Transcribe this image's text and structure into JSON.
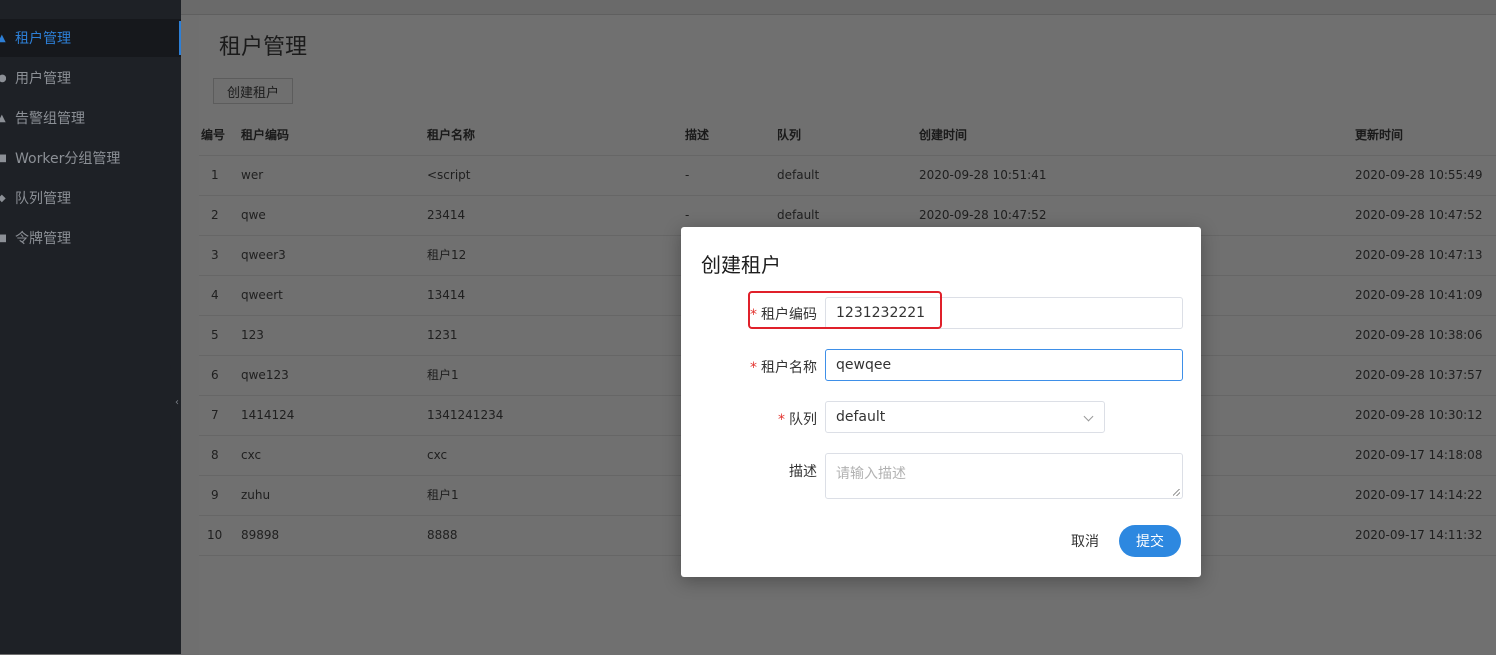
{
  "sidebar": {
    "items": [
      {
        "label": "租户管理",
        "icon": "user-icon",
        "active": true
      },
      {
        "label": "用户管理",
        "icon": "person-icon",
        "active": false
      },
      {
        "label": "告警组管理",
        "icon": "warning-icon",
        "active": false
      },
      {
        "label": "Worker分组管理",
        "icon": "server-icon",
        "active": false
      },
      {
        "label": "队列管理",
        "icon": "queue-icon",
        "active": false
      },
      {
        "label": "令牌管理",
        "icon": "token-icon",
        "active": false
      }
    ],
    "collapse_glyph": "‹"
  },
  "page": {
    "title": "租户管理",
    "create_button": "创建租户"
  },
  "table": {
    "headers": {
      "index": "编号",
      "code": "租户编码",
      "name": "租户名称",
      "desc": "描述",
      "queue": "队列",
      "created": "创建时间",
      "updated": "更新时间"
    },
    "rows": [
      {
        "index": "1",
        "code": "wer",
        "name": "<script",
        "desc": "-",
        "queue": "default",
        "created": "2020-09-28 10:51:41",
        "updated": "2020-09-28 10:55:49"
      },
      {
        "index": "2",
        "code": "qwe",
        "name": "23414",
        "desc": "-",
        "queue": "default",
        "created": "2020-09-28 10:47:52",
        "updated": "2020-09-28 10:47:52"
      },
      {
        "index": "3",
        "code": "qweer3",
        "name": "租户12",
        "desc": "",
        "queue": "",
        "created": "",
        "updated": "2020-09-28 10:47:13"
      },
      {
        "index": "4",
        "code": "qweert",
        "name": "13414",
        "desc": "",
        "queue": "",
        "created": "",
        "updated": "2020-09-28 10:41:09"
      },
      {
        "index": "5",
        "code": "123",
        "name": "1231",
        "desc": "",
        "queue": "",
        "created": "",
        "updated": "2020-09-28 10:38:06"
      },
      {
        "index": "6",
        "code": "qwe123",
        "name": "租户1",
        "desc": "",
        "queue": "",
        "created": "",
        "updated": "2020-09-28 10:37:57"
      },
      {
        "index": "7",
        "code": "1414124",
        "name": "1341241234",
        "desc": "",
        "queue": "",
        "created": "",
        "updated": "2020-09-28 10:30:12"
      },
      {
        "index": "8",
        "code": "cxc",
        "name": "cxc",
        "desc": "",
        "queue": "",
        "created": "",
        "updated": "2020-09-17 14:18:08"
      },
      {
        "index": "9",
        "code": "zuhu",
        "name": "租户1",
        "desc": "",
        "queue": "",
        "created": "",
        "updated": "2020-09-17 14:14:22"
      },
      {
        "index": "10",
        "code": "89898",
        "name": "8888",
        "desc": "",
        "queue": "",
        "created": "",
        "updated": "2020-09-17 14:11:32"
      }
    ]
  },
  "modal": {
    "title": "创建租户",
    "required_mark": "*",
    "fields": {
      "code": {
        "label": "租户编码",
        "value": "1231232221"
      },
      "name": {
        "label": "租户名称",
        "value": "qewqee"
      },
      "queue": {
        "label": "队列",
        "value": "default"
      },
      "desc": {
        "label": "描述",
        "placeholder": "请输入描述"
      }
    },
    "cancel_label": "取消",
    "submit_label": "提交"
  },
  "colors": {
    "accent": "#2d88e0",
    "highlight_box": "#e0202a",
    "sidebar_bg": "#1e2126"
  }
}
